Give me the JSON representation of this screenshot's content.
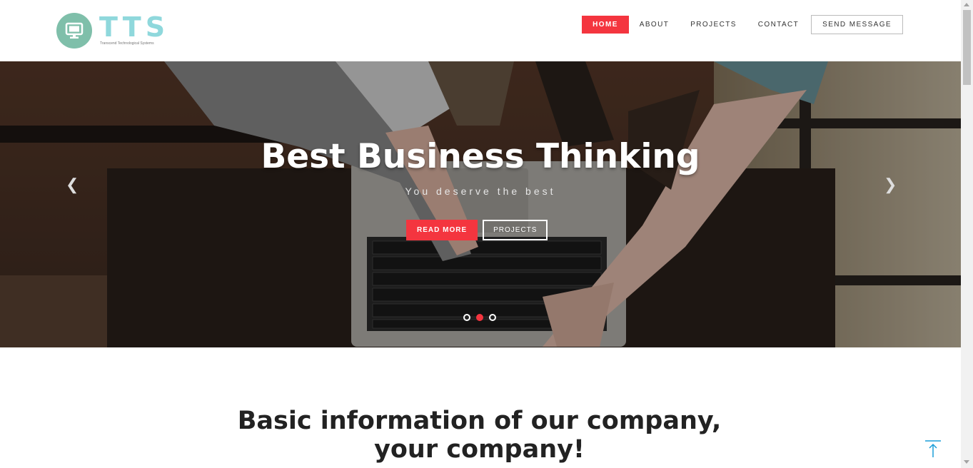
{
  "brand": {
    "name": "TTS",
    "tagline": "Transcend Technological Systems",
    "logo_icon": "monitor-icon",
    "color": "#8fd8dc"
  },
  "nav": {
    "items": [
      "HOME",
      "ABOUT",
      "PROJECTS",
      "CONTACT"
    ],
    "active": "HOME",
    "cta": "SEND MESSAGE"
  },
  "hero": {
    "title": "Best Business Thinking",
    "subtitle": "You deserve the best",
    "primary_button": "READ MORE",
    "secondary_button": "PROJECTS",
    "prev_icon": "chevron-left-icon",
    "next_icon": "chevron-right-icon",
    "slides": 3,
    "active_slide": 2
  },
  "about": {
    "heading": "Basic information of our company, your company!"
  },
  "scroll_top_icon": "arrow-up-icon",
  "colors": {
    "accent": "#f4353f",
    "logo_circle": "#7fbfaa",
    "scroll_top": "#1a9ed9"
  }
}
